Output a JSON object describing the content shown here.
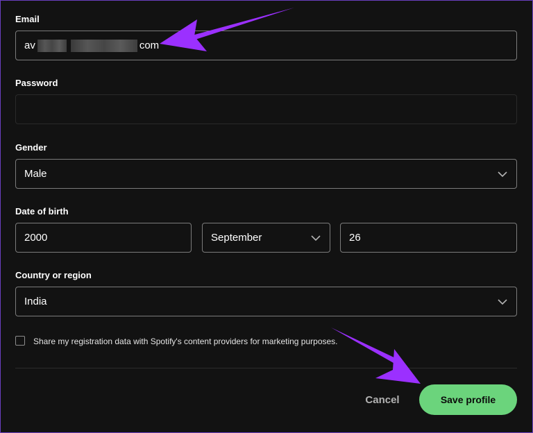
{
  "email": {
    "label": "Email",
    "value_start": "av",
    "value_end": "com"
  },
  "password": {
    "label": "Password",
    "value": ""
  },
  "gender": {
    "label": "Gender",
    "selected": "Male",
    "icon": "chevron-down-icon"
  },
  "dob": {
    "label": "Date of birth",
    "year": "2000",
    "month": "September",
    "day": "26"
  },
  "country": {
    "label": "Country or region",
    "selected": "India"
  },
  "marketing": {
    "label": "Share my registration data with Spotify's content providers for marketing purposes.",
    "checked": false
  },
  "actions": {
    "cancel": "Cancel",
    "save": "Save profile"
  },
  "colors": {
    "accent": "#6bd47c",
    "annotation_arrow": "#9b30ff",
    "background": "#121212"
  }
}
